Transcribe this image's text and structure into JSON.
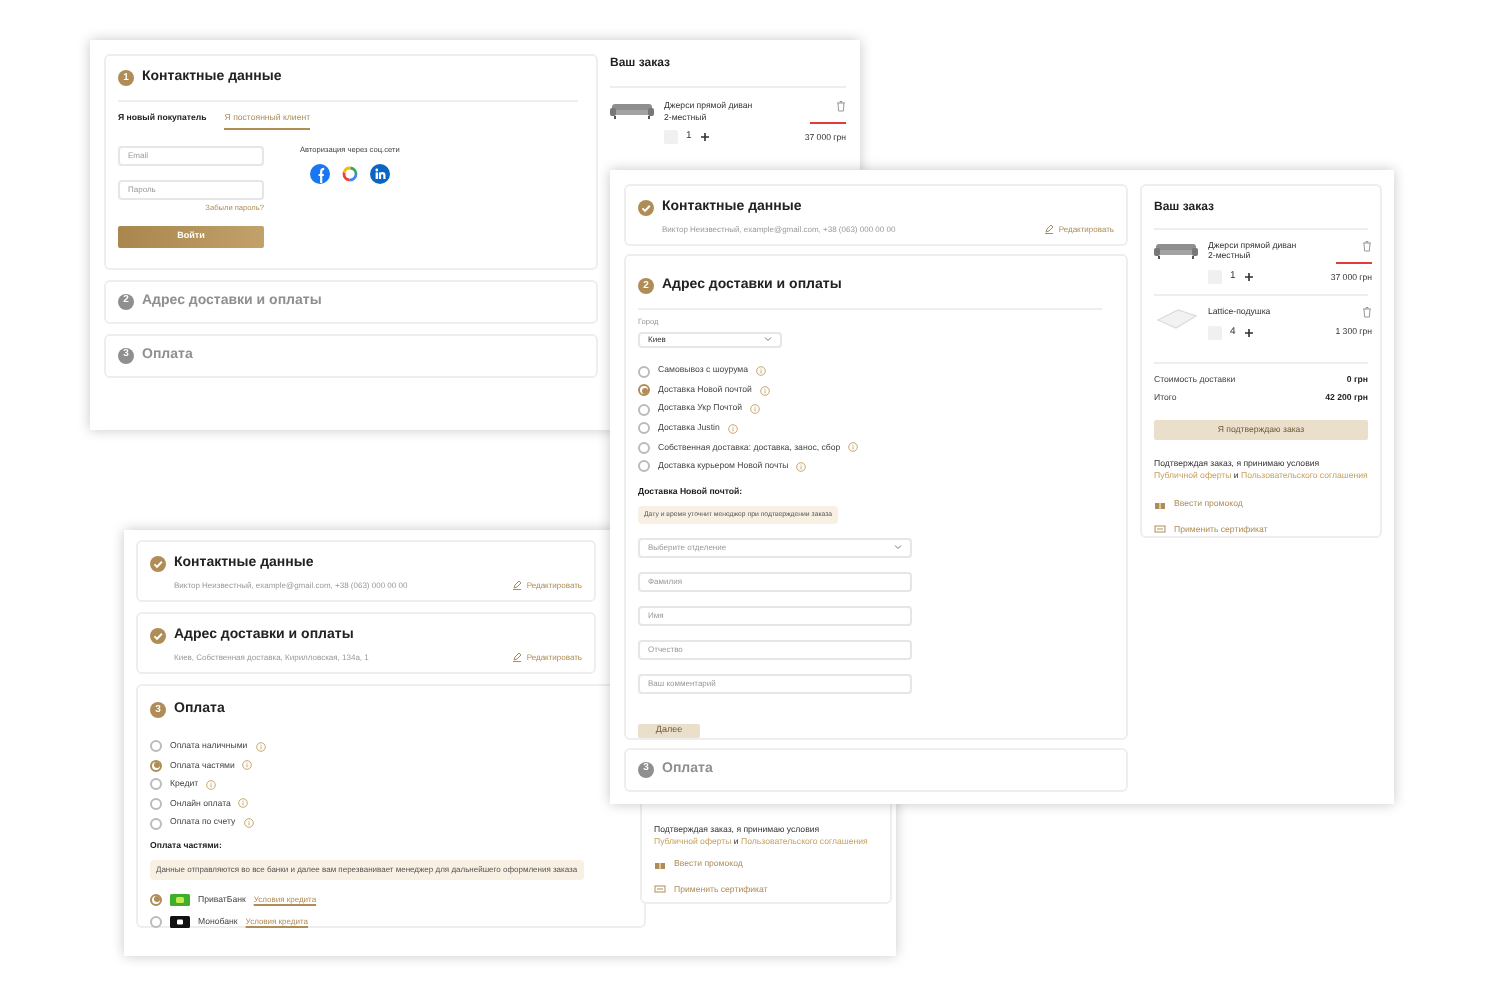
{
  "login_screen": {
    "steps": [
      {
        "completed": false,
        "current": true,
        "number": "1",
        "title": "Контактные данные"
      },
      {
        "completed": false,
        "current": false,
        "number": "2",
        "title": "Адрес доставки и оплаты"
      },
      {
        "completed": false,
        "current": false,
        "number": "3",
        "title": "Оплата"
      }
    ],
    "tabs": [
      {
        "label": "Я новый покупатель",
        "selected": false
      },
      {
        "label": "Я постоянный клиент",
        "selected": true
      }
    ],
    "email_placeholder": "Email",
    "password_placeholder": "Пароль",
    "forgot_link": "Забыли пароль?",
    "login_button": "Войти",
    "social_label": "Авторизация через соц.сети",
    "order": {
      "title": "Ваш заказ",
      "items": [
        {
          "kind": "sofa",
          "name": "Джерси прямой диван 2-местный",
          "qty": "1",
          "price": "37 000 грн"
        }
      ]
    }
  },
  "delivery_screen": {
    "steps": [
      {
        "completed": true,
        "title": "Контактные данные",
        "summary": "Виктор Неизвестный, example@gmail.com, +38 (063) 000 00 00",
        "edit": "Редактировать"
      },
      {
        "completed": false,
        "current": true,
        "number": "2",
        "title": "Адрес доставки и оплаты"
      },
      {
        "completed": false,
        "current": false,
        "number": "3",
        "title": "Оплата"
      }
    ],
    "city_label": "Город",
    "city": "Киев",
    "delivery_options": [
      {
        "label": "Самовывоз с шоурума",
        "selected": false
      },
      {
        "label": "Доставка Новой почтой",
        "selected": true
      },
      {
        "label": "Доставка Укр Почтой",
        "selected": false
      },
      {
        "label": "Доставка Justin",
        "selected": false
      },
      {
        "label": "Собственная доставка: доставка, занос, сбор",
        "selected": false
      },
      {
        "label": "Доставка курьером Новой почты",
        "selected": false
      }
    ],
    "note_title": "Доставка Новой почтой:",
    "note": "Дату и время уточнит менеджер при подтверждении заказа",
    "branch_placeholder": "Выберите отделение",
    "field_placeholders": [
      "Фамилия",
      "Имя",
      "Отчество",
      "Ваш комментарий"
    ],
    "next_button": {
      "label": "Далее",
      "disabled": true
    },
    "order": {
      "title": "Ваш заказ",
      "items": [
        {
          "kind": "sofa",
          "name": "Джерси прямой диван 2-местный",
          "qty": "1",
          "price": "37 000 грн"
        },
        {
          "kind": "pillow",
          "name": "Lattice-подушка",
          "qty": "4",
          "price": "1 300 грн"
        }
      ],
      "totals": [
        {
          "label": "Стоимость доставки",
          "value": "0 грн"
        },
        {
          "label": "Итого",
          "value": "42 200 грн"
        }
      ],
      "confirm_button": {
        "label": "Я подтверждаю заказ",
        "disabled": true
      },
      "terms": "Подтверждая заказ, я принимаю условия",
      "terms_links": [
        "Публичной оферты",
        "Пользовательского соглашения"
      ],
      "terms_joiner": "и",
      "actions": [
        {
          "kind": "promo",
          "label": "Ввести промокод"
        },
        {
          "kind": "certificate",
          "label": "Применить сертификат"
        }
      ]
    }
  },
  "payment_screen": {
    "steps": [
      {
        "completed": true,
        "title": "Контактные данные",
        "summary": "Виктор Неизвестный, example@gmail.com, +38 (063) 000 00 00",
        "edit": "Редактировать"
      },
      {
        "completed": true,
        "title": "Адрес доставки и оплаты",
        "summary": "Киев, Собственная доставка, Кирилловская, 134а, 1",
        "edit": "Редактировать"
      },
      {
        "completed": false,
        "current": true,
        "number": "3",
        "title": "Оплата"
      }
    ],
    "payment_options": [
      {
        "label": "Оплата наличными",
        "selected": false
      },
      {
        "label": "Оплата частями",
        "selected": true
      },
      {
        "label": "Кредит",
        "selected": false
      },
      {
        "label": "Онлайн оплата",
        "selected": false
      },
      {
        "label": "Оплата по счету",
        "selected": false
      }
    ],
    "note_title": "Оплата частями:",
    "note": "Данные отправляются во все банки и далее вам перезванивает менеджер для дальнейшего оформления заказа",
    "banks": [
      {
        "kind": "privat",
        "name": "ПриватБанк",
        "link": "Условия кредита",
        "selected": true
      },
      {
        "kind": "mono",
        "name": "Монобанк",
        "link": "Условия кредита",
        "selected": false
      }
    ],
    "order": {
      "terms": "Подтверждая заказ, я принимаю условия",
      "terms_links": [
        "Публичной оферты",
        "Пользовательского соглашения"
      ],
      "terms_joiner": "и",
      "actions": [
        {
          "kind": "promo",
          "label": "Ввести промокод"
        },
        {
          "kind": "certificate",
          "label": "Применить сертификат"
        }
      ]
    }
  }
}
